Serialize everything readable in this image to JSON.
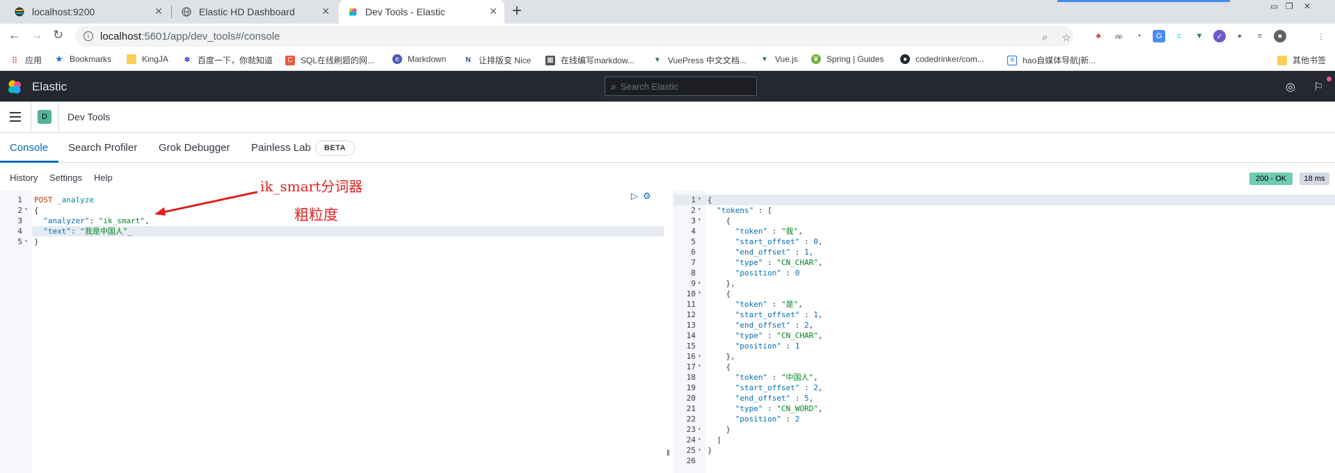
{
  "browser": {
    "tabs": [
      {
        "title": "localhost:9200",
        "active": false
      },
      {
        "title": "Elastic HD Dashboard",
        "active": false
      },
      {
        "title": "Dev Tools - Elastic",
        "active": true
      }
    ],
    "url_host": "localhost",
    "url_rest": ":5601/app/dev_tools#/console",
    "bookmarks": [
      "应用",
      "Bookmarks",
      "KingJA",
      "百度一下，你就知道",
      "SQL在线刷题的网...",
      "Markdown",
      "让排版变 Nice",
      "在线编写markdow...",
      "VuePress 中文文档...",
      "Vue.js",
      "Spring | Guides",
      "codedrinker/com...",
      "hao自媒体导航|新...",
      "其他书签"
    ]
  },
  "kibana": {
    "brand": "Elastic",
    "search_placeholder": "Search Elastic",
    "breadcrumb_badge": "D",
    "breadcrumb_title": "Dev Tools",
    "tabs": [
      "Console",
      "Search Profiler",
      "Grok Debugger",
      "Painless Lab"
    ],
    "beta_label": "BETA",
    "console_links": [
      "History",
      "Settings",
      "Help"
    ],
    "status_badge": "200 - OK",
    "time_badge": "18 ms"
  },
  "request": {
    "lines": [
      {
        "n": "1",
        "parts": [
          [
            "kw",
            "POST "
          ],
          [
            "url",
            "_analyze"
          ]
        ]
      },
      {
        "n": "2",
        "parts": [
          [
            "pun",
            "{"
          ]
        ]
      },
      {
        "n": "3",
        "parts": [
          [
            "pun",
            "  "
          ],
          [
            "key",
            "\"analyzer\""
          ],
          [
            "pun",
            ": "
          ],
          [
            "str",
            "\"ik_smart\""
          ],
          [
            "pun",
            ","
          ]
        ]
      },
      {
        "n": "4",
        "parts": [
          [
            "pun",
            "  "
          ],
          [
            "key",
            "\"text\""
          ],
          [
            "pun",
            ": "
          ],
          [
            "str",
            "\"我是中国人\""
          ],
          [
            "pun",
            "_"
          ]
        ]
      },
      {
        "n": "5",
        "parts": [
          [
            "pun",
            "}"
          ]
        ]
      }
    ]
  },
  "response": {
    "lines": [
      {
        "n": "1",
        "parts": [
          [
            "pun",
            "{"
          ]
        ]
      },
      {
        "n": "2",
        "parts": [
          [
            "pun",
            "  "
          ],
          [
            "key",
            "\"tokens\""
          ],
          [
            "pun",
            " : ["
          ]
        ]
      },
      {
        "n": "3",
        "parts": [
          [
            "pun",
            "    {"
          ]
        ]
      },
      {
        "n": "4",
        "parts": [
          [
            "pun",
            "      "
          ],
          [
            "key",
            "\"token\""
          ],
          [
            "pun",
            " : "
          ],
          [
            "str",
            "\"我\""
          ],
          [
            "pun",
            ","
          ]
        ]
      },
      {
        "n": "5",
        "parts": [
          [
            "pun",
            "      "
          ],
          [
            "key",
            "\"start_offset\""
          ],
          [
            "pun",
            " : "
          ],
          [
            "num",
            "0"
          ],
          [
            "pun",
            ","
          ]
        ]
      },
      {
        "n": "6",
        "parts": [
          [
            "pun",
            "      "
          ],
          [
            "key",
            "\"end_offset\""
          ],
          [
            "pun",
            " : "
          ],
          [
            "num",
            "1"
          ],
          [
            "pun",
            ","
          ]
        ]
      },
      {
        "n": "7",
        "parts": [
          [
            "pun",
            "      "
          ],
          [
            "key",
            "\"type\""
          ],
          [
            "pun",
            " : "
          ],
          [
            "str",
            "\"CN_CHAR\""
          ],
          [
            "pun",
            ","
          ]
        ]
      },
      {
        "n": "8",
        "parts": [
          [
            "pun",
            "      "
          ],
          [
            "key",
            "\"position\""
          ],
          [
            "pun",
            " : "
          ],
          [
            "num",
            "0"
          ]
        ]
      },
      {
        "n": "9",
        "parts": [
          [
            "pun",
            "    },"
          ]
        ]
      },
      {
        "n": "10",
        "parts": [
          [
            "pun",
            "    {"
          ]
        ]
      },
      {
        "n": "11",
        "parts": [
          [
            "pun",
            "      "
          ],
          [
            "key",
            "\"token\""
          ],
          [
            "pun",
            " : "
          ],
          [
            "str",
            "\"是\""
          ],
          [
            "pun",
            ","
          ]
        ]
      },
      {
        "n": "12",
        "parts": [
          [
            "pun",
            "      "
          ],
          [
            "key",
            "\"start_offset\""
          ],
          [
            "pun",
            " : "
          ],
          [
            "num",
            "1"
          ],
          [
            "pun",
            ","
          ]
        ]
      },
      {
        "n": "13",
        "parts": [
          [
            "pun",
            "      "
          ],
          [
            "key",
            "\"end_offset\""
          ],
          [
            "pun",
            " : "
          ],
          [
            "num",
            "2"
          ],
          [
            "pun",
            ","
          ]
        ]
      },
      {
        "n": "14",
        "parts": [
          [
            "pun",
            "      "
          ],
          [
            "key",
            "\"type\""
          ],
          [
            "pun",
            " : "
          ],
          [
            "str",
            "\"CN_CHAR\""
          ],
          [
            "pun",
            ","
          ]
        ]
      },
      {
        "n": "15",
        "parts": [
          [
            "pun",
            "      "
          ],
          [
            "key",
            "\"position\""
          ],
          [
            "pun",
            " : "
          ],
          [
            "num",
            "1"
          ]
        ]
      },
      {
        "n": "16",
        "parts": [
          [
            "pun",
            "    },"
          ]
        ]
      },
      {
        "n": "17",
        "parts": [
          [
            "pun",
            "    {"
          ]
        ]
      },
      {
        "n": "18",
        "parts": [
          [
            "pun",
            "      "
          ],
          [
            "key",
            "\"token\""
          ],
          [
            "pun",
            " : "
          ],
          [
            "str",
            "\"中国人\""
          ],
          [
            "pun",
            ","
          ]
        ]
      },
      {
        "n": "19",
        "parts": [
          [
            "pun",
            "      "
          ],
          [
            "key",
            "\"start_offset\""
          ],
          [
            "pun",
            " : "
          ],
          [
            "num",
            "2"
          ],
          [
            "pun",
            ","
          ]
        ]
      },
      {
        "n": "20",
        "parts": [
          [
            "pun",
            "      "
          ],
          [
            "key",
            "\"end_offset\""
          ],
          [
            "pun",
            " : "
          ],
          [
            "num",
            "5"
          ],
          [
            "pun",
            ","
          ]
        ]
      },
      {
        "n": "21",
        "parts": [
          [
            "pun",
            "      "
          ],
          [
            "key",
            "\"type\""
          ],
          [
            "pun",
            " : "
          ],
          [
            "str",
            "\"CN_WORD\""
          ],
          [
            "pun",
            ","
          ]
        ]
      },
      {
        "n": "22",
        "parts": [
          [
            "pun",
            "      "
          ],
          [
            "key",
            "\"position\""
          ],
          [
            "pun",
            " : "
          ],
          [
            "num",
            "2"
          ]
        ]
      },
      {
        "n": "23",
        "parts": [
          [
            "pun",
            "    }"
          ]
        ]
      },
      {
        "n": "24",
        "parts": [
          [
            "pun",
            "  ]"
          ]
        ]
      },
      {
        "n": "25",
        "parts": [
          [
            "pun",
            "}"
          ]
        ]
      },
      {
        "n": "26",
        "parts": []
      }
    ]
  },
  "annotation": {
    "title": "ik_smart分词器",
    "subtitle": "粗粒度"
  },
  "colors": {
    "accent": "#006bb4",
    "annotation": "#e02020",
    "status_ok": "#6dccb1"
  }
}
